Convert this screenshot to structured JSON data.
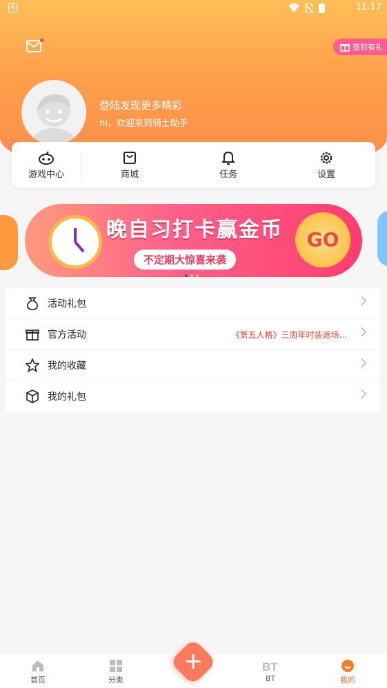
{
  "status_bar": {
    "a_label": "A",
    "time": "11:17"
  },
  "header": {
    "checkin_label": "签到有礼",
    "login_title": "登陆发现更多精彩",
    "login_subtitle": "hi，欢迎来到骑士助手"
  },
  "quick_menu": [
    {
      "label": "游戏中心",
      "icon": "gamepad-icon"
    },
    {
      "label": "商城",
      "icon": "shopping-bag-icon"
    },
    {
      "label": "任务",
      "icon": "bell-icon"
    },
    {
      "label": "设置",
      "icon": "gear-icon"
    }
  ],
  "banner": {
    "title": "晚自习打卡赢金币",
    "pill": "不定期大惊喜来袭",
    "go": "GO"
  },
  "menu": [
    {
      "label": "活动礼包",
      "icon": "money-bag-icon",
      "right": ""
    },
    {
      "label": "官方活动",
      "icon": "gift-icon",
      "right": "《第五人格》三周年时装返场..."
    },
    {
      "label": "我的收藏",
      "icon": "star-icon",
      "right": ""
    },
    {
      "label": "我的礼包",
      "icon": "box-icon",
      "right": ""
    }
  ],
  "tabbar": [
    {
      "label": "首页",
      "icon": "home-icon"
    },
    {
      "label": "分类",
      "icon": "grid-icon"
    },
    {
      "label": "BT",
      "icon": "bt-icon"
    },
    {
      "label": "我的",
      "icon": "profile-icon"
    }
  ],
  "colors": {
    "accent": "#ff6b2c",
    "header_top": "#ffbe57",
    "header_bottom": "#ff8a4a",
    "link_red": "#e8432e"
  }
}
